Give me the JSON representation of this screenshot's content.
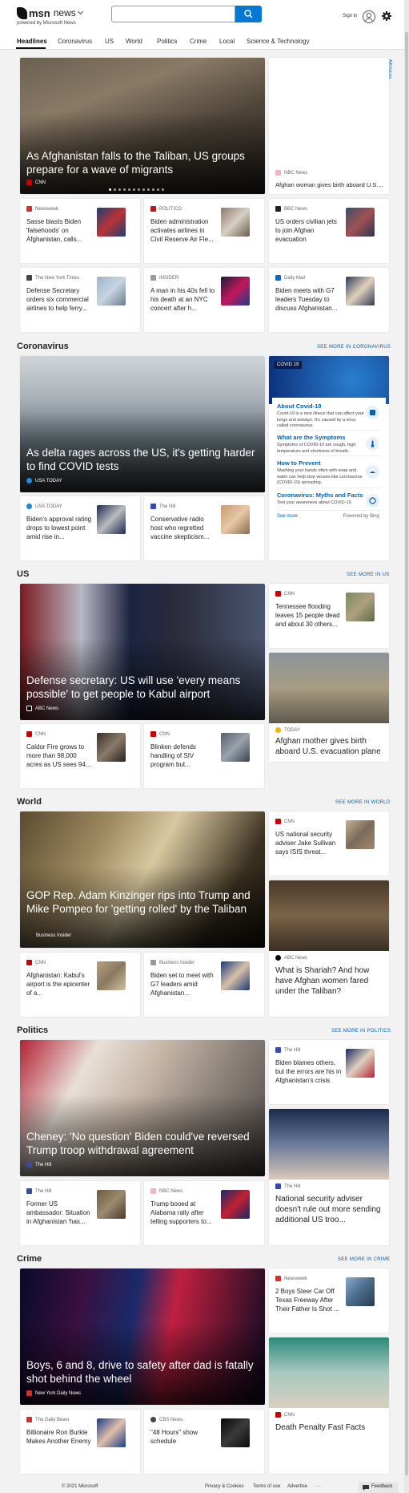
{
  "header": {
    "brand_msn": "msn",
    "brand_news": "news",
    "powered_by": "powered by Microsoft News",
    "search_value": "",
    "sign_in": "Sign in"
  },
  "nav": [
    "Headlines",
    "Coronavirus",
    "US",
    "World",
    "Politics",
    "Crime",
    "Local",
    "Science & Technology"
  ],
  "adchoices": "AdChoices",
  "headlines": {
    "hero": {
      "title": "As Afghanistan falls to the Taliban, US groups prepare for a wave of migrants",
      "source": "CNN"
    },
    "side": {
      "source": "NBC News",
      "title": "Afghan woman gives birth aboard U.S...."
    },
    "small": [
      {
        "source": "Newsweek",
        "title": "Sasse blasts Biden 'falsehoods' on Afghanistan, calls..."
      },
      {
        "source": "POLITICO",
        "title": "Biden administration activates airlines in Civil Reserve Air Fle..."
      },
      {
        "source": "BBC News",
        "title": "US orders civilian jets to join Afghan evacuation"
      },
      {
        "source": "The New York Times",
        "title": "Defense Secretary orders six commercial airlines to help ferry..."
      },
      {
        "source": "INSIDER",
        "title": "A man in his 40s fell to his death at an NYC concert after h..."
      },
      {
        "source": "Daily Mail",
        "title": "Biden meets with G7 leaders Tuesday to discuss Afghanistan..."
      }
    ]
  },
  "coronavirus": {
    "section": "Coronavirus",
    "see_more": "SEE MORE IN CORONAVIRUS",
    "hero": {
      "title": "As delta rages across the US, it's getting harder to find COVID tests",
      "source": "USA TODAY"
    },
    "small": [
      {
        "source": "USA TODAY",
        "title": "Biden's approval rating drops to lowest point amid rise in..."
      },
      {
        "source": "The Hill",
        "title": "Conservative radio host who regretted vaccine skepticism..."
      }
    ],
    "widget": {
      "tag": "COVID 19",
      "items": [
        {
          "title": "About Covid-19",
          "desc": "Covid-19 is a new illness that can affect your lungs and airways. It's caused by a virus called coronavirus."
        },
        {
          "title": "What are the Symptoms",
          "desc": "Symptoms of COVID-19 are cough, high temperature and shortness of breath."
        },
        {
          "title": "How to Prevent",
          "desc": "Washing your hands often with soap and water can help stop viruses like coronavirus (COVID-19) spreading."
        },
        {
          "title": "Coronavirus: Myths and Facts",
          "desc": "Test your awareness about COVID-19."
        }
      ],
      "see_more": "See more",
      "powered": "Powered by Bing"
    }
  },
  "us": {
    "section": "US",
    "see_more": "SEE MORE IN US",
    "hero": {
      "title": "Defense secretary: US will use 'every means possible' to get people to Kabul airport",
      "source": "ABC News"
    },
    "side1": {
      "source": "CNN",
      "title": "Tennessee flooding leaves 15 people dead and about 30 others..."
    },
    "side2": {
      "source": "TODAY",
      "title": "Afghan mother gives birth aboard U.S. evacuation plane"
    },
    "small": [
      {
        "source": "CNN",
        "title": "Caldor Fire grows to more than 98,000 acres as US sees 94..."
      },
      {
        "source": "CNN",
        "title": "Blinken defends handling of SIV program but..."
      }
    ]
  },
  "world": {
    "section": "World",
    "see_more": "SEE MORE IN WORLD",
    "hero": {
      "title": "GOP Rep. Adam Kinzinger rips into Trump and Mike Pompeo for 'getting rolled' by the Taliban",
      "source": "Business Insider"
    },
    "side1": {
      "source": "CNN",
      "title": "US national security adviser Jake Sullivan says ISIS threat..."
    },
    "side2": {
      "source": "ABC News",
      "title": "What is Shariah? And how have Afghan women fared under the Taliban?"
    },
    "small": [
      {
        "source": "CNN",
        "title": "Afghanistan: Kabul's airport is the epicenter of a..."
      },
      {
        "source": "Business Insider",
        "title": "Biden set to meet with G7 leaders amid Afghanistan..."
      }
    ]
  },
  "politics": {
    "section": "Politics",
    "see_more": "SEE MORE IN POLITICS",
    "hero": {
      "title": "Cheney: 'No question' Biden could've reversed Trump troop withdrawal agreement",
      "source": "The Hill"
    },
    "side1": {
      "source": "The Hill",
      "title": "Biden blames others, but the errors are his in Afghanistan's crisis"
    },
    "side2": {
      "source": "The Hill",
      "title": "National security adviser doesn't rule out more sending additional US troo..."
    },
    "small": [
      {
        "source": "The Hill",
        "title": "Former US ambassador: Situation in Afghanistan 'has..."
      },
      {
        "source": "NBC News",
        "title": "Trump booed at Alabama rally after telling supporters to..."
      }
    ]
  },
  "crime": {
    "section": "Crime",
    "see_more": "SEE MORE IN CRIME",
    "hero": {
      "title": "Boys, 6 and 8, drive to safety after dad is fatally shot behind the wheel",
      "source": "New York Daily News"
    },
    "side1": {
      "source": "Newsweek",
      "title": "2 Boys Steer Car Off Texas Freeway After Their Father Is Shot ..."
    },
    "side2": {
      "source": "CNN",
      "title": "Death Penalty Fast Facts"
    },
    "small": [
      {
        "source": "The Daily Beast",
        "title": "Billionaire Ron Burkle Makes Another Enemy"
      },
      {
        "source": "CBS News",
        "title": "\"48 Hours\" show schedule"
      }
    ]
  },
  "footer": {
    "copyright": "© 2021 Microsoft",
    "privacy": "Privacy & Cookies",
    "terms": "Terms of use",
    "advertise": "Advertise",
    "more": "···",
    "feedback": "Feedback"
  }
}
